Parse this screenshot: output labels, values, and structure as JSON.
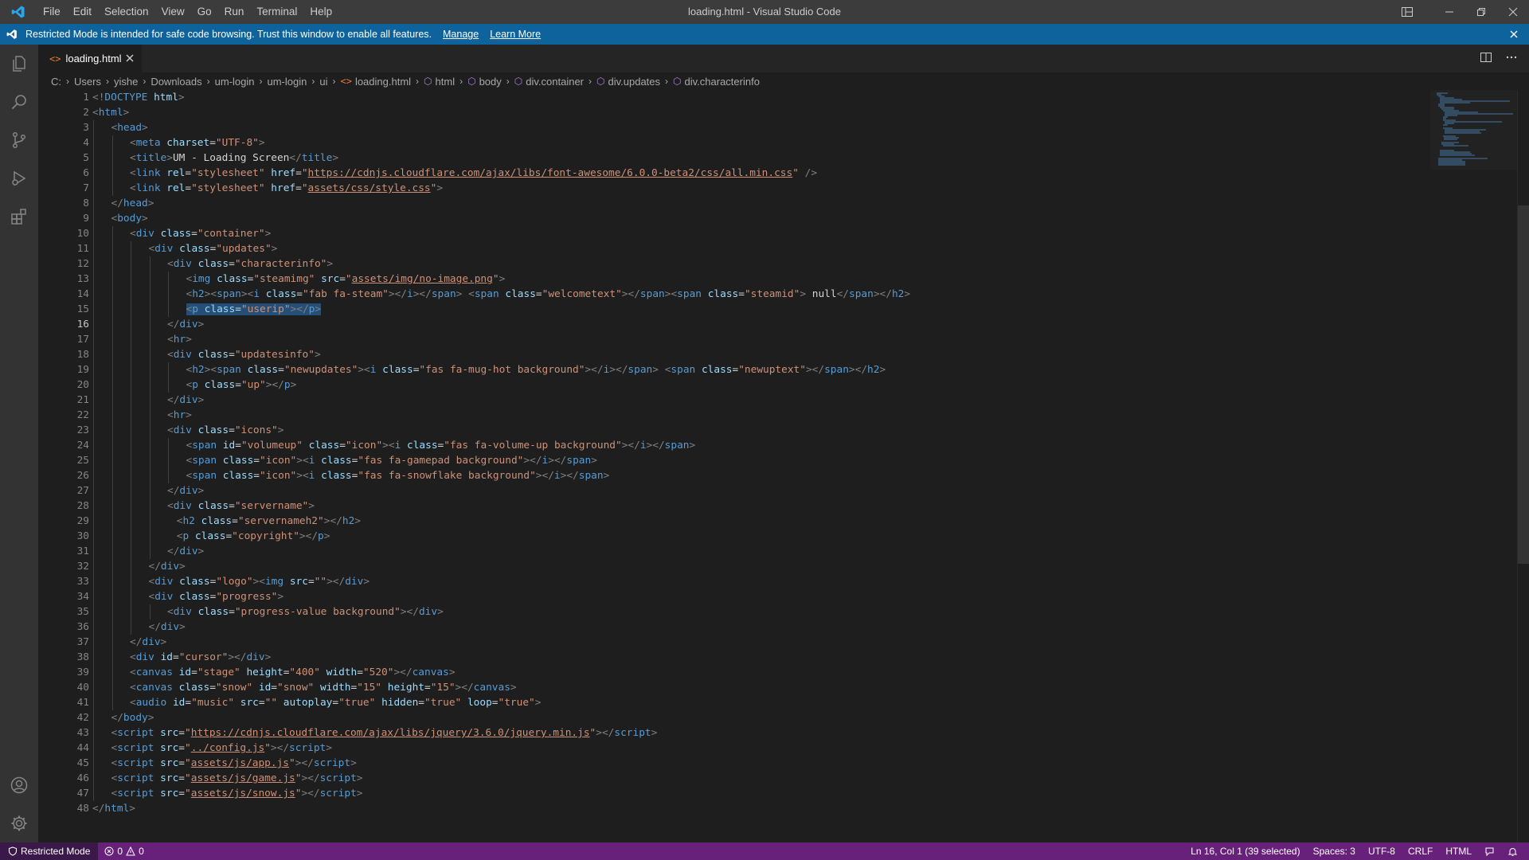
{
  "window": {
    "title": "loading.html - Visual Studio Code",
    "menu": [
      "File",
      "Edit",
      "Selection",
      "View",
      "Go",
      "Run",
      "Terminal",
      "Help"
    ]
  },
  "banner": {
    "message": "Restricted Mode is intended for safe code browsing. Trust this window to enable all features.",
    "manage": "Manage",
    "learn_more": "Learn More"
  },
  "tab": {
    "label": "loading.html"
  },
  "breadcrumbs": [
    "C:",
    "Users",
    "yishe",
    "Downloads",
    "um-login",
    "um-login",
    "ui",
    "loading.html",
    "html",
    "body",
    "div.container",
    "div.updates",
    "div.characterinfo"
  ],
  "editor": {
    "active_line": 16,
    "selected_line": 15,
    "lines": [
      {
        "n": "1",
        "indent": 0,
        "html": "<span class='tok-brk'>&lt;!</span><span class='tok-tag'>DOCTYPE</span> <span class='tok-attr'>html</span><span class='tok-brk'>&gt;</span>"
      },
      {
        "n": "2",
        "indent": 0,
        "html": "<span class='tok-brk'>&lt;</span><span class='tok-tag'>html</span><span class='tok-brk'>&gt;</span>"
      },
      {
        "n": "3",
        "indent": 1,
        "html": "<span class='tok-brk'>&lt;</span><span class='tok-tag'>head</span><span class='tok-brk'>&gt;</span>"
      },
      {
        "n": "4",
        "indent": 2,
        "html": "<span class='tok-brk'>&lt;</span><span class='tok-tag'>meta</span> <span class='tok-attr'>charset</span>=<span class='tok-str'>\"UTF-8\"</span><span class='tok-brk'>&gt;</span>"
      },
      {
        "n": "5",
        "indent": 2,
        "html": "<span class='tok-brk'>&lt;</span><span class='tok-tag'>title</span><span class='tok-brk'>&gt;</span><span class='tok-txt'>UM - Loading Screen</span><span class='tok-brk'>&lt;/</span><span class='tok-tag'>title</span><span class='tok-brk'>&gt;</span>"
      },
      {
        "n": "6",
        "indent": 2,
        "html": "<span class='tok-brk'>&lt;</span><span class='tok-tag'>link</span> <span class='tok-attr'>rel</span>=<span class='tok-str'>\"stylesheet\"</span> <span class='tok-attr'>href</span>=<span class='tok-str'>\"<u>https://cdnjs.cloudflare.com/ajax/libs/font-awesome/6.0.0-beta2/css/all.min.css</u>\"</span> <span class='tok-brk'>/&gt;</span>"
      },
      {
        "n": "7",
        "indent": 2,
        "html": "<span class='tok-brk'>&lt;</span><span class='tok-tag'>link</span> <span class='tok-attr'>rel</span>=<span class='tok-str'>\"stylesheet\"</span> <span class='tok-attr'>href</span>=<span class='tok-str'>\"<u>assets/css/style.css</u>\"</span><span class='tok-brk'>&gt;</span>"
      },
      {
        "n": "8",
        "indent": 1,
        "html": "<span class='tok-brk'>&lt;/</span><span class='tok-tag'>head</span><span class='tok-brk'>&gt;</span>"
      },
      {
        "n": "9",
        "indent": 1,
        "html": "<span class='tok-brk'>&lt;</span><span class='tok-tag'>body</span><span class='tok-brk'>&gt;</span>"
      },
      {
        "n": "10",
        "indent": 2,
        "html": "<span class='tok-brk'>&lt;</span><span class='tok-tag'>div</span> <span class='tok-attr'>class</span>=<span class='tok-str'>\"container\"</span><span class='tok-brk'>&gt;</span>"
      },
      {
        "n": "11",
        "indent": 3,
        "html": "<span class='tok-brk'>&lt;</span><span class='tok-tag'>div</span> <span class='tok-attr'>class</span>=<span class='tok-str'>\"updates\"</span><span class='tok-brk'>&gt;</span>"
      },
      {
        "n": "12",
        "indent": 4,
        "html": "<span class='tok-brk'>&lt;</span><span class='tok-tag'>div</span> <span class='tok-attr'>class</span>=<span class='tok-str'>\"characterinfo\"</span><span class='tok-brk'>&gt;</span>"
      },
      {
        "n": "13",
        "indent": 5,
        "html": "<span class='tok-brk'>&lt;</span><span class='tok-tag'>img</span> <span class='tok-attr'>class</span>=<span class='tok-str'>\"steamimg\"</span> <span class='tok-attr'>src</span>=<span class='tok-str'>\"<u>assets/img/no-image.png</u>\"</span><span class='tok-brk'>&gt;</span>"
      },
      {
        "n": "14",
        "indent": 5,
        "html": "<span class='tok-brk'>&lt;</span><span class='tok-tag'>h2</span><span class='tok-brk'>&gt;&lt;</span><span class='tok-tag'>span</span><span class='tok-brk'>&gt;&lt;</span><span class='tok-tag'>i</span> <span class='tok-attr'>class</span>=<span class='tok-str'>\"fab fa-steam\"</span><span class='tok-brk'>&gt;&lt;/</span><span class='tok-tag'>i</span><span class='tok-brk'>&gt;&lt;/</span><span class='tok-tag'>span</span><span class='tok-brk'>&gt;</span> <span class='tok-brk'>&lt;</span><span class='tok-tag'>span</span> <span class='tok-attr'>class</span>=<span class='tok-str'>\"welcometext\"</span><span class='tok-brk'>&gt;&lt;/</span><span class='tok-tag'>span</span><span class='tok-brk'>&gt;&lt;</span><span class='tok-tag'>span</span> <span class='tok-attr'>class</span>=<span class='tok-str'>\"steamid\"</span><span class='tok-brk'>&gt;</span><span class='tok-txt'> null</span><span class='tok-brk'>&lt;/</span><span class='tok-tag'>span</span><span class='tok-brk'>&gt;&lt;/</span><span class='tok-tag'>h2</span><span class='tok-brk'>&gt;</span>"
      },
      {
        "n": "15",
        "indent": 5,
        "html": "<span class='tok-brk'>&lt;</span><span class='tok-tag'>p</span> <span class='tok-attr'>class</span>=<span class='tok-str'>\"userip\"</span><span class='tok-brk'>&gt;&lt;/</span><span class='tok-tag'>p</span><span class='tok-brk'>&gt;</span>"
      },
      {
        "n": "16",
        "indent": 4,
        "html": "<span class='tok-brk'>&lt;/</span><span class='tok-tag'>div</span><span class='tok-brk'>&gt;</span>"
      },
      {
        "n": "17",
        "indent": 4,
        "html": "<span class='tok-brk'>&lt;</span><span class='tok-tag'>hr</span><span class='tok-brk'>&gt;</span>"
      },
      {
        "n": "18",
        "indent": 4,
        "html": "<span class='tok-brk'>&lt;</span><span class='tok-tag'>div</span> <span class='tok-attr'>class</span>=<span class='tok-str'>\"updatesinfo\"</span><span class='tok-brk'>&gt;</span>"
      },
      {
        "n": "19",
        "indent": 5,
        "html": "<span class='tok-brk'>&lt;</span><span class='tok-tag'>h2</span><span class='tok-brk'>&gt;&lt;</span><span class='tok-tag'>span</span> <span class='tok-attr'>class</span>=<span class='tok-str'>\"newupdates\"</span><span class='tok-brk'>&gt;&lt;</span><span class='tok-tag'>i</span> <span class='tok-attr'>class</span>=<span class='tok-str'>\"fas fa-mug-hot background\"</span><span class='tok-brk'>&gt;&lt;/</span><span class='tok-tag'>i</span><span class='tok-brk'>&gt;&lt;/</span><span class='tok-tag'>span</span><span class='tok-brk'>&gt;</span> <span class='tok-brk'>&lt;</span><span class='tok-tag'>span</span> <span class='tok-attr'>class</span>=<span class='tok-str'>\"newuptext\"</span><span class='tok-brk'>&gt;&lt;/</span><span class='tok-tag'>span</span><span class='tok-brk'>&gt;&lt;/</span><span class='tok-tag'>h2</span><span class='tok-brk'>&gt;</span>"
      },
      {
        "n": "20",
        "indent": 5,
        "html": "<span class='tok-brk'>&lt;</span><span class='tok-tag'>p</span> <span class='tok-attr'>class</span>=<span class='tok-str'>\"up\"</span><span class='tok-brk'>&gt;&lt;/</span><span class='tok-tag'>p</span><span class='tok-brk'>&gt;</span>"
      },
      {
        "n": "21",
        "indent": 4,
        "html": "<span class='tok-brk'>&lt;/</span><span class='tok-tag'>div</span><span class='tok-brk'>&gt;</span>"
      },
      {
        "n": "22",
        "indent": 4,
        "html": "<span class='tok-brk'>&lt;</span><span class='tok-tag'>hr</span><span class='tok-brk'>&gt;</span>"
      },
      {
        "n": "23",
        "indent": 4,
        "html": "<span class='tok-brk'>&lt;</span><span class='tok-tag'>div</span> <span class='tok-attr'>class</span>=<span class='tok-str'>\"icons\"</span><span class='tok-brk'>&gt;</span>"
      },
      {
        "n": "24",
        "indent": 5,
        "html": "<span class='tok-brk'>&lt;</span><span class='tok-tag'>span</span> <span class='tok-attr'>id</span>=<span class='tok-str'>\"volumeup\"</span> <span class='tok-attr'>class</span>=<span class='tok-str'>\"icon\"</span><span class='tok-brk'>&gt;&lt;</span><span class='tok-tag'>i</span> <span class='tok-attr'>class</span>=<span class='tok-str'>\"fas fa-volume-up background\"</span><span class='tok-brk'>&gt;&lt;/</span><span class='tok-tag'>i</span><span class='tok-brk'>&gt;&lt;/</span><span class='tok-tag'>span</span><span class='tok-brk'>&gt;</span>"
      },
      {
        "n": "25",
        "indent": 5,
        "html": "<span class='tok-brk'>&lt;</span><span class='tok-tag'>span</span> <span class='tok-attr'>class</span>=<span class='tok-str'>\"icon\"</span><span class='tok-brk'>&gt;&lt;</span><span class='tok-tag'>i</span> <span class='tok-attr'>class</span>=<span class='tok-str'>\"fas fa-gamepad background\"</span><span class='tok-brk'>&gt;&lt;/</span><span class='tok-tag'>i</span><span class='tok-brk'>&gt;&lt;/</span><span class='tok-tag'>span</span><span class='tok-brk'>&gt;</span>"
      },
      {
        "n": "26",
        "indent": 5,
        "html": "<span class='tok-brk'>&lt;</span><span class='tok-tag'>span</span> <span class='tok-attr'>class</span>=<span class='tok-str'>\"icon\"</span><span class='tok-brk'>&gt;&lt;</span><span class='tok-tag'>i</span> <span class='tok-attr'>class</span>=<span class='tok-str'>\"fas fa-snowflake background\"</span><span class='tok-brk'>&gt;&lt;/</span><span class='tok-tag'>i</span><span class='tok-brk'>&gt;&lt;/</span><span class='tok-tag'>span</span><span class='tok-brk'>&gt;</span>"
      },
      {
        "n": "27",
        "indent": 4,
        "html": "<span class='tok-brk'>&lt;/</span><span class='tok-tag'>div</span><span class='tok-brk'>&gt;</span>"
      },
      {
        "n": "28",
        "indent": 4,
        "html": "<span class='tok-brk'>&lt;</span><span class='tok-tag'>div</span> <span class='tok-attr'>class</span>=<span class='tok-str'>\"servername\"</span><span class='tok-brk'>&gt;</span>"
      },
      {
        "n": "29",
        "indent": 4.5,
        "html": "<span class='tok-brk'>&lt;</span><span class='tok-tag'>h2</span> <span class='tok-attr'>class</span>=<span class='tok-str'>\"servernameh2\"</span><span class='tok-brk'>&gt;&lt;/</span><span class='tok-tag'>h2</span><span class='tok-brk'>&gt;</span>"
      },
      {
        "n": "30",
        "indent": 4.5,
        "html": "<span class='tok-brk'>&lt;</span><span class='tok-tag'>p</span> <span class='tok-attr'>class</span>=<span class='tok-str'>\"copyright\"</span><span class='tok-brk'>&gt;&lt;/</span><span class='tok-tag'>p</span><span class='tok-brk'>&gt;</span>"
      },
      {
        "n": "31",
        "indent": 4,
        "html": "<span class='tok-brk'>&lt;/</span><span class='tok-tag'>div</span><span class='tok-brk'>&gt;</span>"
      },
      {
        "n": "32",
        "indent": 3,
        "html": "<span class='tok-brk'>&lt;/</span><span class='tok-tag'>div</span><span class='tok-brk'>&gt;</span>"
      },
      {
        "n": "33",
        "indent": 3,
        "html": "<span class='tok-brk'>&lt;</span><span class='tok-tag'>div</span> <span class='tok-attr'>class</span>=<span class='tok-str'>\"logo\"</span><span class='tok-brk'>&gt;&lt;</span><span class='tok-tag'>img</span> <span class='tok-attr'>src</span>=<span class='tok-str'>\"\"</span><span class='tok-brk'>&gt;&lt;/</span><span class='tok-tag'>div</span><span class='tok-brk'>&gt;</span>"
      },
      {
        "n": "34",
        "indent": 3,
        "html": "<span class='tok-brk'>&lt;</span><span class='tok-tag'>div</span> <span class='tok-attr'>class</span>=<span class='tok-str'>\"progress\"</span><span class='tok-brk'>&gt;</span>"
      },
      {
        "n": "35",
        "indent": 4,
        "html": "<span class='tok-brk'>&lt;</span><span class='tok-tag'>div</span> <span class='tok-attr'>class</span>=<span class='tok-str'>\"progress-value background\"</span><span class='tok-brk'>&gt;&lt;/</span><span class='tok-tag'>div</span><span class='tok-brk'>&gt;</span>"
      },
      {
        "n": "36",
        "indent": 3,
        "html": "<span class='tok-brk'>&lt;/</span><span class='tok-tag'>div</span><span class='tok-brk'>&gt;</span>"
      },
      {
        "n": "37",
        "indent": 2,
        "html": "<span class='tok-brk'>&lt;/</span><span class='tok-tag'>div</span><span class='tok-brk'>&gt;</span>"
      },
      {
        "n": "38",
        "indent": 2,
        "html": "<span class='tok-brk'>&lt;</span><span class='tok-tag'>div</span> <span class='tok-attr'>id</span>=<span class='tok-str'>\"cursor\"</span><span class='tok-brk'>&gt;&lt;/</span><span class='tok-tag'>div</span><span class='tok-brk'>&gt;</span>"
      },
      {
        "n": "39",
        "indent": 2,
        "html": "<span class='tok-brk'>&lt;</span><span class='tok-tag'>canvas</span> <span class='tok-attr'>id</span>=<span class='tok-str'>\"stage\"</span> <span class='tok-attr'>height</span>=<span class='tok-str'>\"400\"</span> <span class='tok-attr'>width</span>=<span class='tok-str'>\"520\"</span><span class='tok-brk'>&gt;&lt;/</span><span class='tok-tag'>canvas</span><span class='tok-brk'>&gt;</span>"
      },
      {
        "n": "40",
        "indent": 2,
        "html": "<span class='tok-brk'>&lt;</span><span class='tok-tag'>canvas</span> <span class='tok-attr'>class</span>=<span class='tok-str'>\"snow\"</span> <span class='tok-attr'>id</span>=<span class='tok-str'>\"snow\"</span> <span class='tok-attr'>width</span>=<span class='tok-str'>\"15\"</span> <span class='tok-attr'>height</span>=<span class='tok-str'>\"15\"</span><span class='tok-brk'>&gt;&lt;/</span><span class='tok-tag'>canvas</span><span class='tok-brk'>&gt;</span>"
      },
      {
        "n": "41",
        "indent": 2,
        "html": "<span class='tok-brk'>&lt;</span><span class='tok-tag'>audio</span> <span class='tok-attr'>id</span>=<span class='tok-str'>\"music\"</span> <span class='tok-attr'>src</span>=<span class='tok-str'>\"\"</span> <span class='tok-attr'>autoplay</span>=<span class='tok-str'>\"true\"</span> <span class='tok-attr'>hidden</span>=<span class='tok-str'>\"true\"</span> <span class='tok-attr'>loop</span>=<span class='tok-str'>\"true\"</span><span class='tok-brk'>&gt;</span>"
      },
      {
        "n": "42",
        "indent": 1,
        "html": "<span class='tok-brk'>&lt;/</span><span class='tok-tag'>body</span><span class='tok-brk'>&gt;</span>"
      },
      {
        "n": "43",
        "indent": 1,
        "html": "<span class='tok-brk'>&lt;</span><span class='tok-tag'>script</span> <span class='tok-attr'>src</span>=<span class='tok-str'>\"<u>https://cdnjs.cloudflare.com/ajax/libs/jquery/3.6.0/jquery.min.js</u>\"</span><span class='tok-brk'>&gt;&lt;/</span><span class='tok-tag'>script</span><span class='tok-brk'>&gt;</span>"
      },
      {
        "n": "44",
        "indent": 1,
        "html": "<span class='tok-brk'>&lt;</span><span class='tok-tag'>script</span> <span class='tok-attr'>src</span>=<span class='tok-str'>\"<u>../config.js</u>\"</span><span class='tok-brk'>&gt;&lt;/</span><span class='tok-tag'>script</span><span class='tok-brk'>&gt;</span>"
      },
      {
        "n": "45",
        "indent": 1,
        "html": "<span class='tok-brk'>&lt;</span><span class='tok-tag'>script</span> <span class='tok-attr'>src</span>=<span class='tok-str'>\"<u>assets/js/app.js</u>\"</span><span class='tok-brk'>&gt;&lt;/</span><span class='tok-tag'>script</span><span class='tok-brk'>&gt;</span>"
      },
      {
        "n": "46",
        "indent": 1,
        "html": "<span class='tok-brk'>&lt;</span><span class='tok-tag'>script</span> <span class='tok-attr'>src</span>=<span class='tok-str'>\"<u>assets/js/game.js</u>\"</span><span class='tok-brk'>&gt;&lt;/</span><span class='tok-tag'>script</span><span class='tok-brk'>&gt;</span>"
      },
      {
        "n": "47",
        "indent": 1,
        "html": "<span class='tok-brk'>&lt;</span><span class='tok-tag'>script</span> <span class='tok-attr'>src</span>=<span class='tok-str'>\"<u>assets/js/snow.js</u>\"</span><span class='tok-brk'>&gt;&lt;/</span><span class='tok-tag'>script</span><span class='tok-brk'>&gt;</span>"
      },
      {
        "n": "48",
        "indent": 0,
        "html": "<span class='tok-brk'>&lt;/</span><span class='tok-tag'>html</span><span class='tok-brk'>&gt;</span>"
      }
    ]
  },
  "status": {
    "mode": "Restricted Mode",
    "errors": "0",
    "warnings": "0",
    "position": "Ln 16, Col 1 (39 selected)",
    "spaces": "Spaces: 3",
    "encoding": "UTF-8",
    "eol": "CRLF",
    "language": "HTML"
  },
  "colors": {
    "titlebar": "#3c3c3c",
    "banner": "#0e639c",
    "statusbar_restricted": "#68217a",
    "editor_bg": "#1e1e1e"
  }
}
